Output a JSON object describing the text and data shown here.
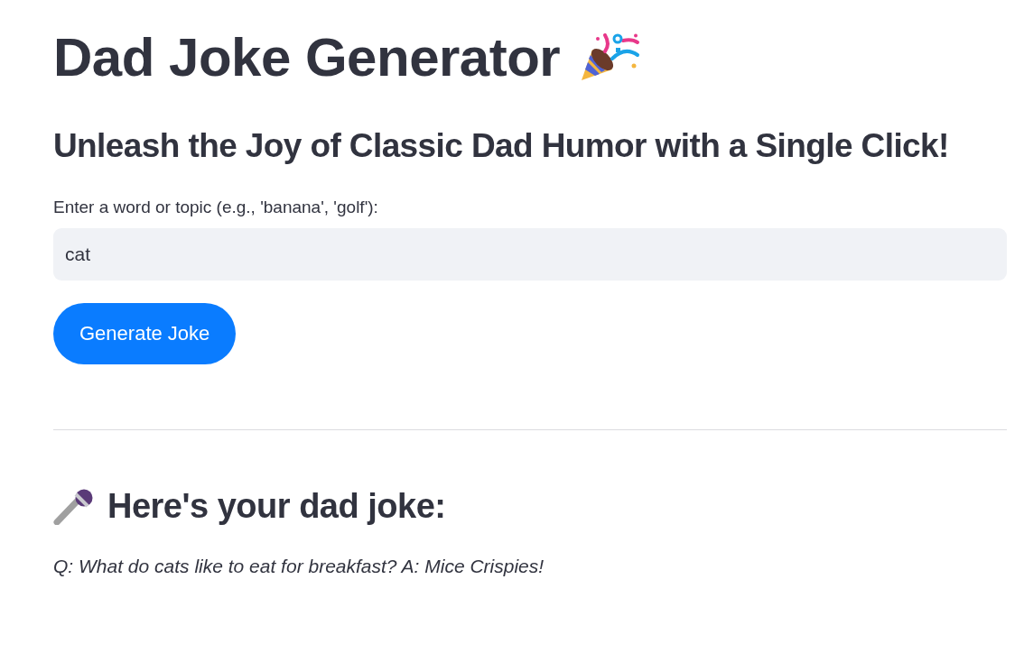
{
  "title": "Dad Joke Generator",
  "subtitle": "Unleash the Joy of Classic Dad Humor with a Single Click!",
  "topic_field": {
    "label": "Enter a word or topic (e.g., 'banana', 'golf'):",
    "value": "cat"
  },
  "generate_button": {
    "label": "Generate Joke"
  },
  "result": {
    "heading": "Here's your dad joke:",
    "joke": "Q: What do cats like to eat for breakfast? A: Mice Crispies!"
  }
}
